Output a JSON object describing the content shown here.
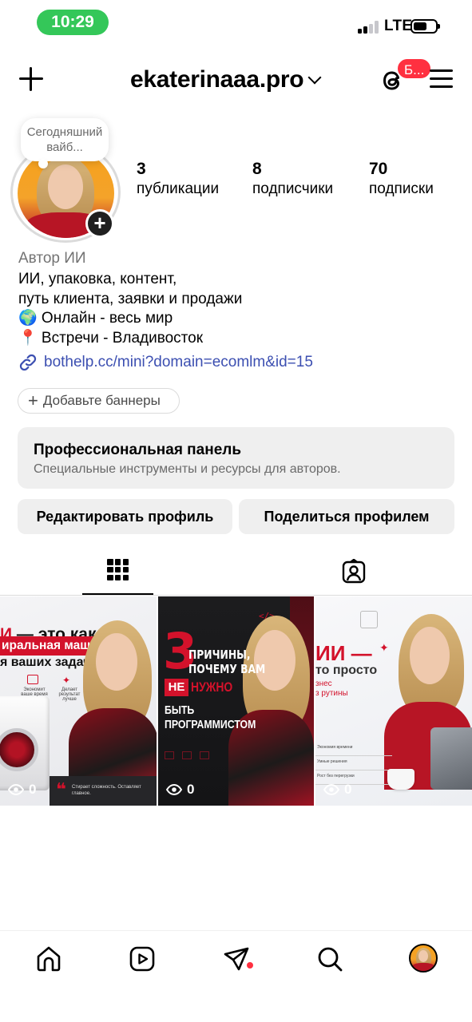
{
  "status_bar": {
    "time": "10:29",
    "network": "LTE",
    "accent_color": "#34c759"
  },
  "header": {
    "username": "ekaterinaaa.pro",
    "threads_badge": "Б...",
    "icons": [
      "plus-icon",
      "chevron-down-icon",
      "threads-icon",
      "menu-icon"
    ]
  },
  "profile": {
    "note": "Сегодняшний вайб...",
    "stats": [
      {
        "value": "3",
        "label": "публикации"
      },
      {
        "value": "8",
        "label": "подписчики"
      },
      {
        "value": "70",
        "label": "подписки"
      }
    ],
    "category": "Автор ИИ",
    "bio_lines": [
      "ИИ, упаковка, контент,",
      "путь клиента, заявки и продажи",
      "🌍 Онлайн - весь мир",
      "📍 Встречи - Владивосток"
    ],
    "link": "bothelp.cc/mini?domain=ecomlm&id=15",
    "banner_button": "Добавьте баннеры"
  },
  "pro_panel": {
    "title": "Профессиональная панель",
    "subtitle": "Специальные инструменты и ресурсы для авторов."
  },
  "actions": {
    "edit": "Редактировать профиль",
    "share": "Поделиться профилем"
  },
  "tabs": [
    {
      "name": "grid",
      "icon": "grid-icon",
      "active": true
    },
    {
      "name": "tagged",
      "icon": "tagged-person-icon",
      "active": false
    }
  ],
  "posts": [
    {
      "title_red": "И",
      "title_rest": " — это как",
      "band": "иральная машина",
      "line3": "я ваших задач",
      "icon_labels": [
        "Экономит ваше время",
        "Делает результат лучше"
      ],
      "quote": "Стирает сложность. Оставляет главное.",
      "views": "0"
    },
    {
      "code": "</>",
      "number": "3",
      "line1": "ПРИЧИНЫ,",
      "line2": "ПОЧЕМУ ВАМ",
      "ne": "НЕ",
      "nuzhno": "НУЖНО",
      "line4": "БЫТЬ",
      "line5": "ПРОГРАММИСТОМ",
      "views": "0"
    },
    {
      "title": "ИИ —",
      "line2": "то просто",
      "line3a": "знес",
      "line3b": "з рутины",
      "list": [
        "Экономия времени",
        "Умные решения",
        "Рост без перегрузки"
      ],
      "views": "0"
    }
  ],
  "bottom_nav": [
    "home-icon",
    "reels-icon",
    "direct-icon",
    "search-icon",
    "profile-avatar"
  ],
  "colors": {
    "brand_red": "#d3122b",
    "badge_red": "#ff3040",
    "link_blue": "#3c4fb1"
  }
}
